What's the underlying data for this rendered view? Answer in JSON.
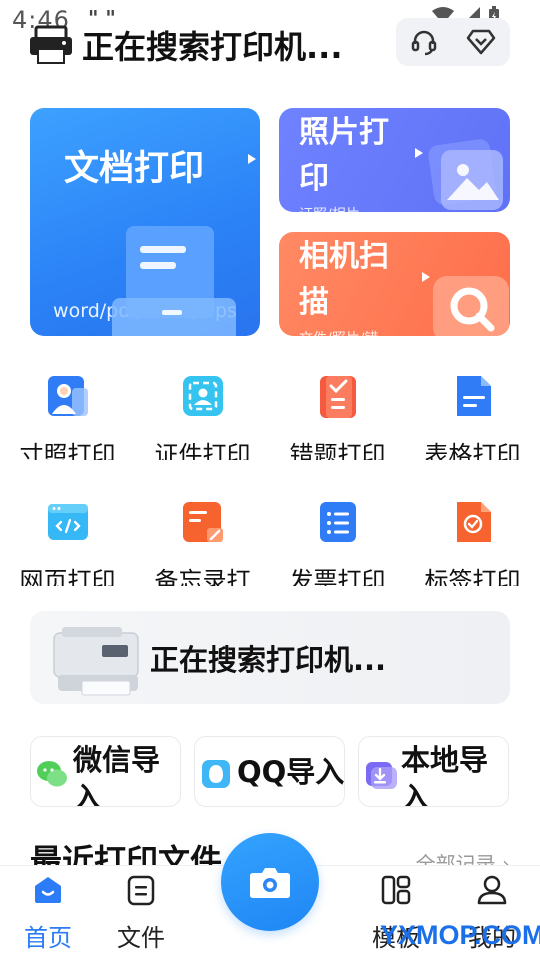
{
  "status_bar": {
    "time": "4:46",
    "indicators": "\" \""
  },
  "header": {
    "title": "正在搜索打印机..."
  },
  "cards": {
    "doc": {
      "title": "文档打印",
      "subtitle": "word/pdf/excel/wps"
    },
    "photo": {
      "title": "照片打印",
      "subtitle": "证照/相片"
    },
    "scan": {
      "title": "相机扫描",
      "subtitle": "文件/照片/错"
    }
  },
  "grid": [
    {
      "label": "寸照打印",
      "icon": "id-photo-icon"
    },
    {
      "label": "证件打印",
      "icon": "id-card-icon"
    },
    {
      "label": "错题打印",
      "icon": "wrong-question-icon"
    },
    {
      "label": "表格打印",
      "icon": "table-doc-icon"
    },
    {
      "label": "网页打印",
      "icon": "webpage-icon"
    },
    {
      "label": "备忘录打",
      "icon": "memo-icon"
    },
    {
      "label": "发票打印",
      "icon": "invoice-icon"
    },
    {
      "label": "标签打印",
      "icon": "label-icon"
    }
  ],
  "banner": {
    "text": "正在搜索打印机..."
  },
  "imports": [
    {
      "label": "微信导入",
      "icon": "wechat-icon"
    },
    {
      "label": "QQ导入",
      "icon": "qq-icon"
    },
    {
      "label": "本地导入",
      "icon": "local-import-icon"
    }
  ],
  "recent": {
    "title": "最近打印文件",
    "all": "全部记录 ›"
  },
  "tabs": [
    {
      "label": "首页",
      "icon": "home-icon",
      "active": true
    },
    {
      "label": "文件",
      "icon": "file-icon",
      "active": false
    },
    {
      "label": "模板",
      "icon": "template-icon",
      "active": false
    },
    {
      "label": "我的",
      "icon": "profile-icon",
      "active": false
    }
  ],
  "watermark": "YXMOP.COM",
  "colors": {
    "accent": "#2b7cf6",
    "doc_card": "#2b82f6",
    "photo_card": "#6f82ff",
    "scan_card": "#ff7a55"
  }
}
